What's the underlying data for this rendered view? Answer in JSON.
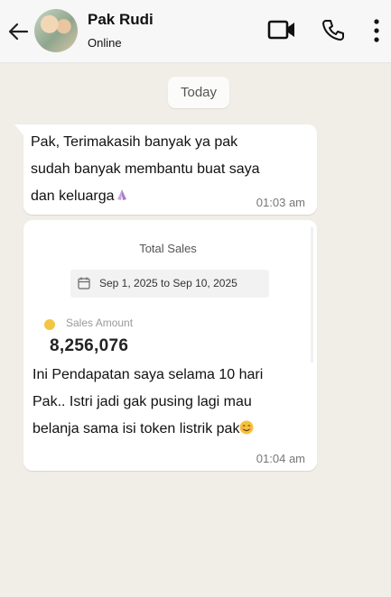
{
  "header": {
    "contact_name": "Pak Rudi",
    "status": "Online",
    "icons": [
      "back-arrow-icon",
      "avatar",
      "video-call-icon",
      "phone-icon",
      "more-menu-icon"
    ]
  },
  "date_chip": "Today",
  "messages": [
    {
      "text": "Pak, Terimakasih banyak ya pak\nsudah banyak membantu buat saya\ndan keluarga",
      "emoji": "folded-hands",
      "time": "01:03 am"
    },
    {
      "card": {
        "title": "Total Sales",
        "date_range": "Sep 1, 2025 to Sep 10, 2025",
        "sales_label": "Sales Amount",
        "sales_value": "8,256,076"
      },
      "text": "Ini Pendapatan saya selama 10 hari\nPak.. Istri jadi gak pusing lagi mau\nbelanja sama isi token listrik pak",
      "emoji": "smiling-face",
      "time": "01:04 am"
    }
  ],
  "colors": {
    "background": "#f1ede7",
    "header": "#f7f7f7",
    "bubble": "#ffffff",
    "dot": "#f4c542"
  }
}
